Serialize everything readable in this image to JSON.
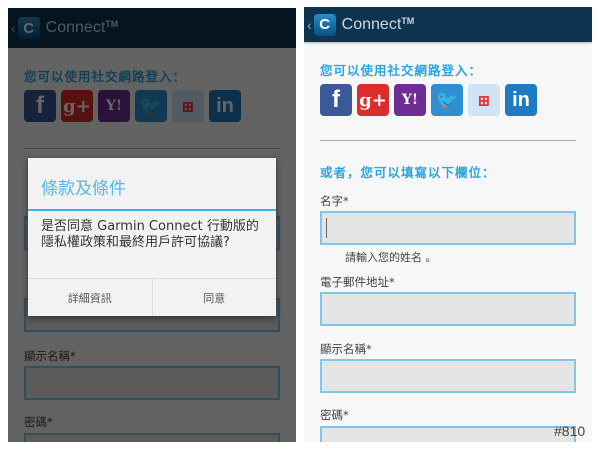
{
  "app": {
    "title": "Connect",
    "tm": "TM",
    "logo_letter": "C",
    "back": "‹"
  },
  "social": {
    "heading": "您可以使用社交網路登入：",
    "icons": [
      {
        "name": "facebook-icon",
        "glyph": "f"
      },
      {
        "name": "google-plus-icon",
        "glyph": "g+"
      },
      {
        "name": "yahoo-icon",
        "glyph": "Y!"
      },
      {
        "name": "twitter-icon",
        "glyph": "🐦"
      },
      {
        "name": "windows-icon",
        "glyph": "⊞"
      },
      {
        "name": "linkedin-icon",
        "glyph": "in"
      }
    ]
  },
  "form": {
    "heading": "或者，您可以填寫以下欄位：",
    "name_label": "名字*",
    "name_hint": "請輸入您的姓名 。",
    "email_label": "電子郵件地址*",
    "display_name_label": "顯示名稱*",
    "password_label": "密碼*"
  },
  "dialog": {
    "title": "條款及條件",
    "body": "是否同意 Garmin Connect 行動版的隱私權政策和最終用戶許可協議?",
    "details": "詳細資訊",
    "agree": "同意"
  },
  "watermark": "#810"
}
